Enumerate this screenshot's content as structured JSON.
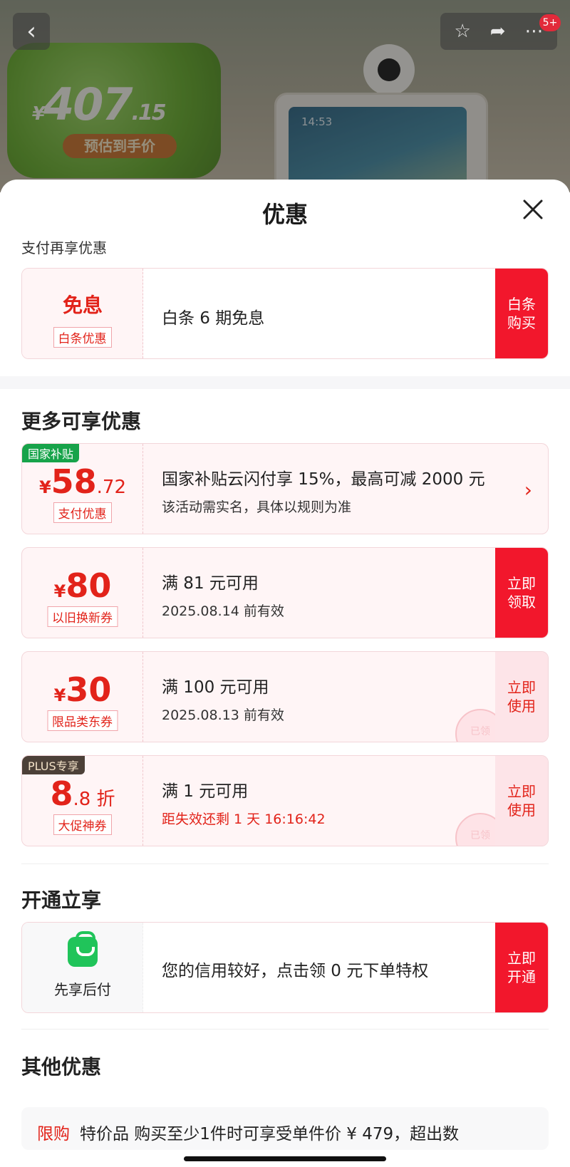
{
  "background": {
    "price_yen": "¥",
    "price_int": "407",
    "price_dec": ".15",
    "price_tag": "预估到手价",
    "screen_time": "14:53",
    "cart_badge": "5+",
    "icons": {
      "back": "back-icon",
      "favorite": "star-icon",
      "share": "share-icon",
      "more": "more-icon"
    }
  },
  "sheet": {
    "title": "优惠",
    "close_icon": "close-icon"
  },
  "pay_section": {
    "label": "支付再享优惠",
    "card": {
      "big": "免息",
      "tag": "白条优惠",
      "line1": "白条 6 期免息",
      "button": [
        "白条",
        "购买"
      ]
    }
  },
  "more_section": {
    "title": "更多可享优惠",
    "cards": [
      {
        "corner": "国家补贴",
        "yen": "¥",
        "num": "58",
        "sm": ".72",
        "tag": "支付优惠",
        "line1": "国家补贴云闪付享 15%，最高可减 2000 元",
        "line2": "该活动需实名，具体以规则为准",
        "chevron": "›"
      },
      {
        "yen": "¥",
        "num": "80",
        "tag": "以旧换新券",
        "line1": "满 81 元可用",
        "line2": "2025.08.14 前有效",
        "button": [
          "立即",
          "领取"
        ]
      },
      {
        "yen": "¥",
        "num": "30",
        "tag": "限品类东券",
        "line1": "满 100 元可用",
        "line2": "2025.08.13 前有效",
        "button": [
          "立即",
          "使用"
        ],
        "stamp": "已领"
      },
      {
        "corner": "PLUS专享",
        "num": "8",
        "sm": ".8 折",
        "tag": "大促神券",
        "line1": "满 1 元可用",
        "line2": "距失效还剩 1 天 16:16:42",
        "button": [
          "立即",
          "使用"
        ],
        "stamp": "已领"
      }
    ]
  },
  "open_section": {
    "title": "开通立享",
    "card": {
      "icon": "shopping-bag-icon",
      "label": "先享后付",
      "line1": "您的信用较好，点击领 0 元下单特权",
      "button": [
        "立即",
        "开通"
      ]
    }
  },
  "other_section": {
    "title": "其他优惠",
    "row_tag": "限购",
    "row_text": "特价品 购买至少1件时可享受单件价 ¥ 479，超出数"
  },
  "colors": {
    "accent": "#f2172c",
    "soft": "#fde4e8",
    "green": "#17a34a"
  }
}
